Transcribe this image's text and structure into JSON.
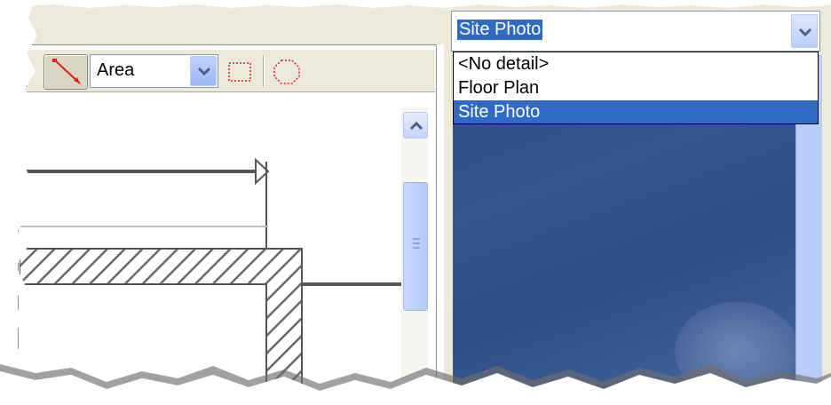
{
  "toolbar": {
    "measure_tool_icon": "red-diagonal-line-icon",
    "area_select_value": "Area",
    "rect_tool_icon": "dotted-rectangle-icon",
    "polygon_tool_icon": "dotted-octagon-icon"
  },
  "detail_select": {
    "value": "Site Photo",
    "options": [
      "<No detail>",
      "Floor Plan",
      "Site Photo"
    ],
    "selected_index": 2
  },
  "colors": {
    "selection_blue": "#316ac5",
    "measure_line_red": "#e02020",
    "photo_blue": "#34528c"
  }
}
